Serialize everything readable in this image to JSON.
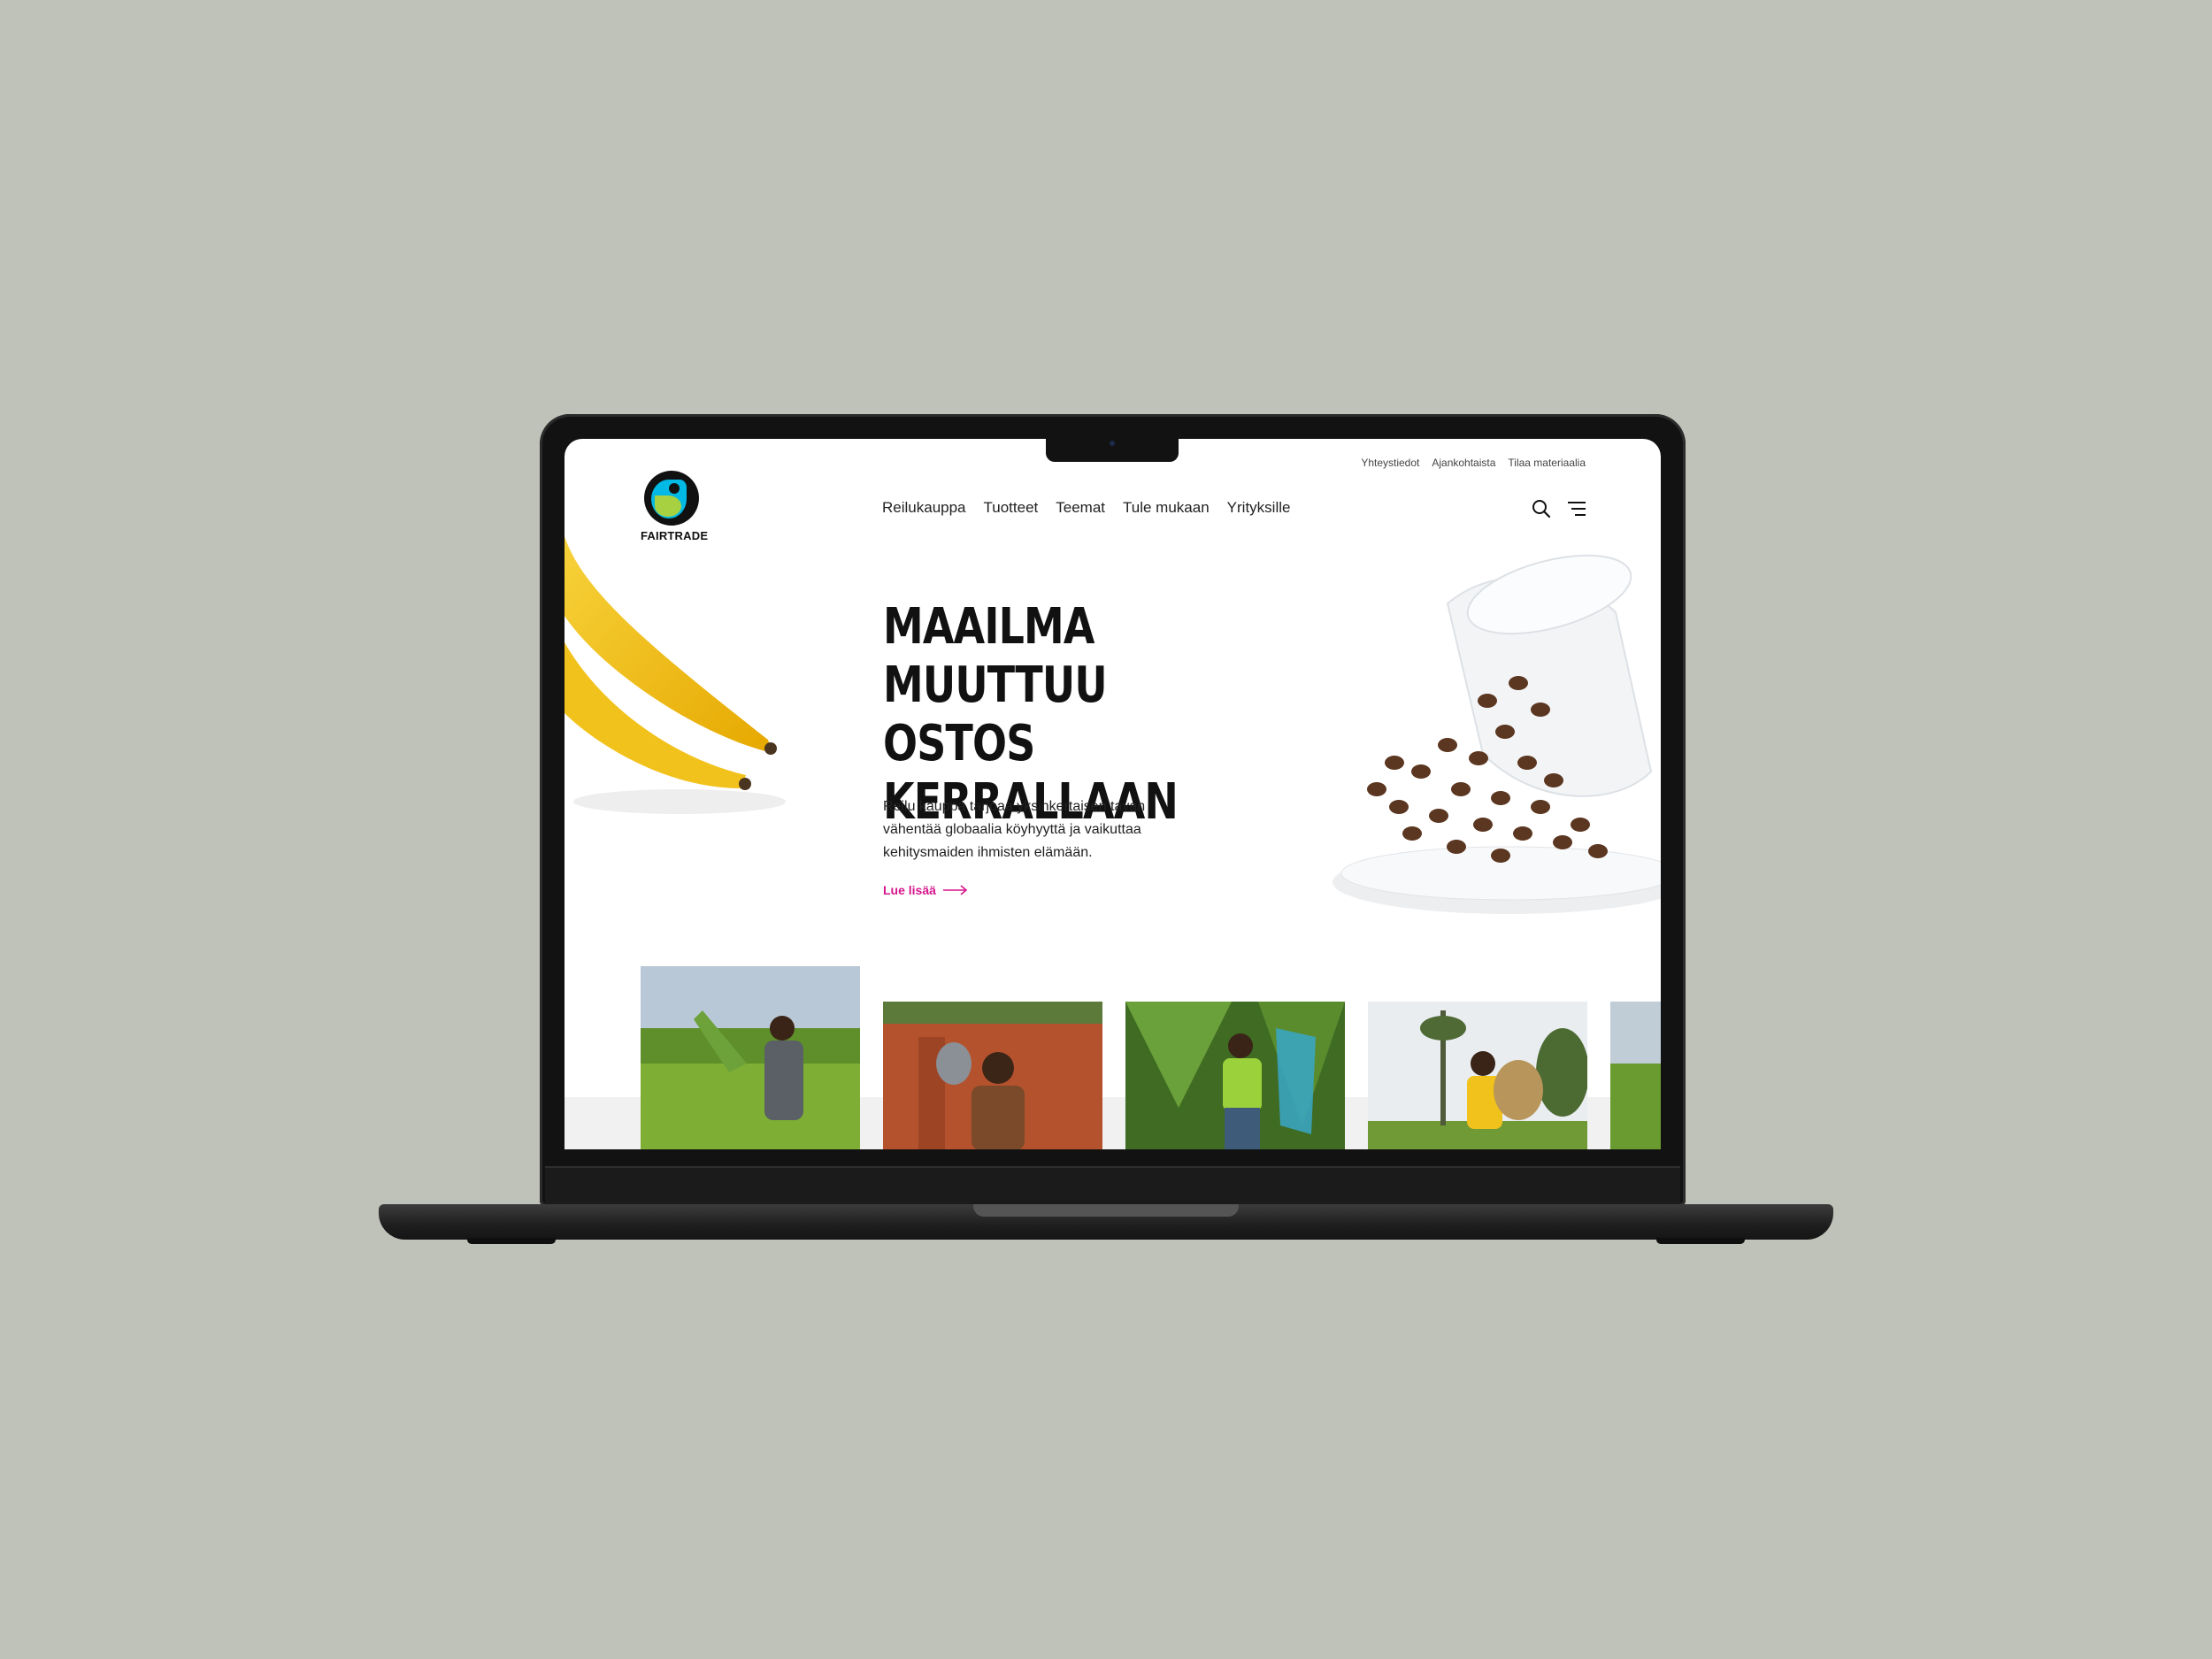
{
  "utility_nav": [
    "Yhteystiedot",
    "Ajankohtaista",
    "Tilaa materiaalia"
  ],
  "logo": {
    "text": "FAIRTRADE"
  },
  "main_nav": [
    "Reilukauppa",
    "Tuotteet",
    "Teemat",
    "Tule mukaan",
    "Yrityksille"
  ],
  "icons": {
    "search": "search-icon",
    "menu": "menu-icon",
    "arrow": "arrow-right-icon"
  },
  "hero": {
    "title_lines": [
      "MAAILMA",
      "MUUTTUU OSTOS",
      "KERRALLAAN"
    ],
    "body": "Reilu kauppa tarjoaa yksinkertaisen tavan vähentää globaalia köyhyyttä ja vaikuttaa kehitysmaiden ihmisten elämään.",
    "cta": "Lue lisää"
  },
  "colors": {
    "background": "#bfc2b8",
    "accent": "#d6168c",
    "logo_blue": "#00b9e4",
    "logo_green": "#a8d142",
    "text": "#111111"
  },
  "cards": [
    {
      "name": "card-tea-picker"
    },
    {
      "name": "card-farmer-shovel"
    },
    {
      "name": "card-banana-worker"
    },
    {
      "name": "card-basket-carrier"
    },
    {
      "name": "card-tea-field-partial"
    }
  ]
}
